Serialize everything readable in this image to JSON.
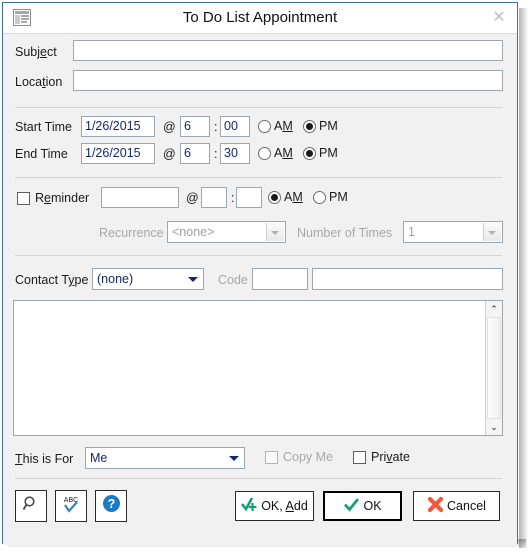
{
  "window": {
    "title": "To Do List Appointment",
    "app_icon": "form-window-icon",
    "close_label": "✕"
  },
  "fields": {
    "subject_label": "Subject",
    "subject_value": "",
    "location_label": "Location",
    "location_value": ""
  },
  "time": {
    "start_label": "Start Time",
    "start_date": "1/26/2015",
    "start_at": "@",
    "start_hour": "6",
    "start_colon": ":",
    "start_minute": "00",
    "start_am": "AM",
    "start_pm": "PM",
    "start_meridiem_selected": "PM",
    "end_label": "End Time",
    "end_date": "1/26/2015",
    "end_at": "@",
    "end_hour": "6",
    "end_colon": ":",
    "end_minute": "30",
    "end_am": "AM",
    "end_pm": "PM",
    "end_meridiem_selected": "PM"
  },
  "reminder": {
    "label": "Reminder",
    "checked": false,
    "date_value": "",
    "at": "@",
    "hour_value": "",
    "colon": ":",
    "minute_value": "",
    "am": "AM",
    "pm": "PM",
    "meridiem_selected": "AM",
    "recurrence_label": "Recurrence",
    "recurrence_value": "<none>",
    "number_of_times_label": "Number of Times",
    "number_of_times_value": "1"
  },
  "contact": {
    "type_label": "Contact Type",
    "type_value": "(none)",
    "code_label": "Code",
    "code_value": "",
    "code_name_value": ""
  },
  "notes": {
    "value": "",
    "scroll_up": "⌃",
    "scroll_down": "⌄"
  },
  "footer": {
    "this_is_for_label": "This is For",
    "this_is_for_value": "Me",
    "copy_me_label": "Copy Me",
    "copy_me_checked": false,
    "private_label": "Private",
    "private_checked": false
  },
  "toolbar": {
    "search_icon": "magnifier-icon",
    "spellcheck_icon": "abc-spellcheck-icon",
    "help_icon": "help-icon"
  },
  "buttons": {
    "ok_add": "OK, Add",
    "ok": "OK",
    "cancel": "Cancel"
  },
  "colors": {
    "window_border": "#3b6ea5",
    "face": "#f1f1f1",
    "field_text": "#14286e",
    "green_check": "#16a07a",
    "red_x": "#f05a3c",
    "help_blue": "#1a7bc8",
    "disabled_text": "#a8a8a8"
  }
}
